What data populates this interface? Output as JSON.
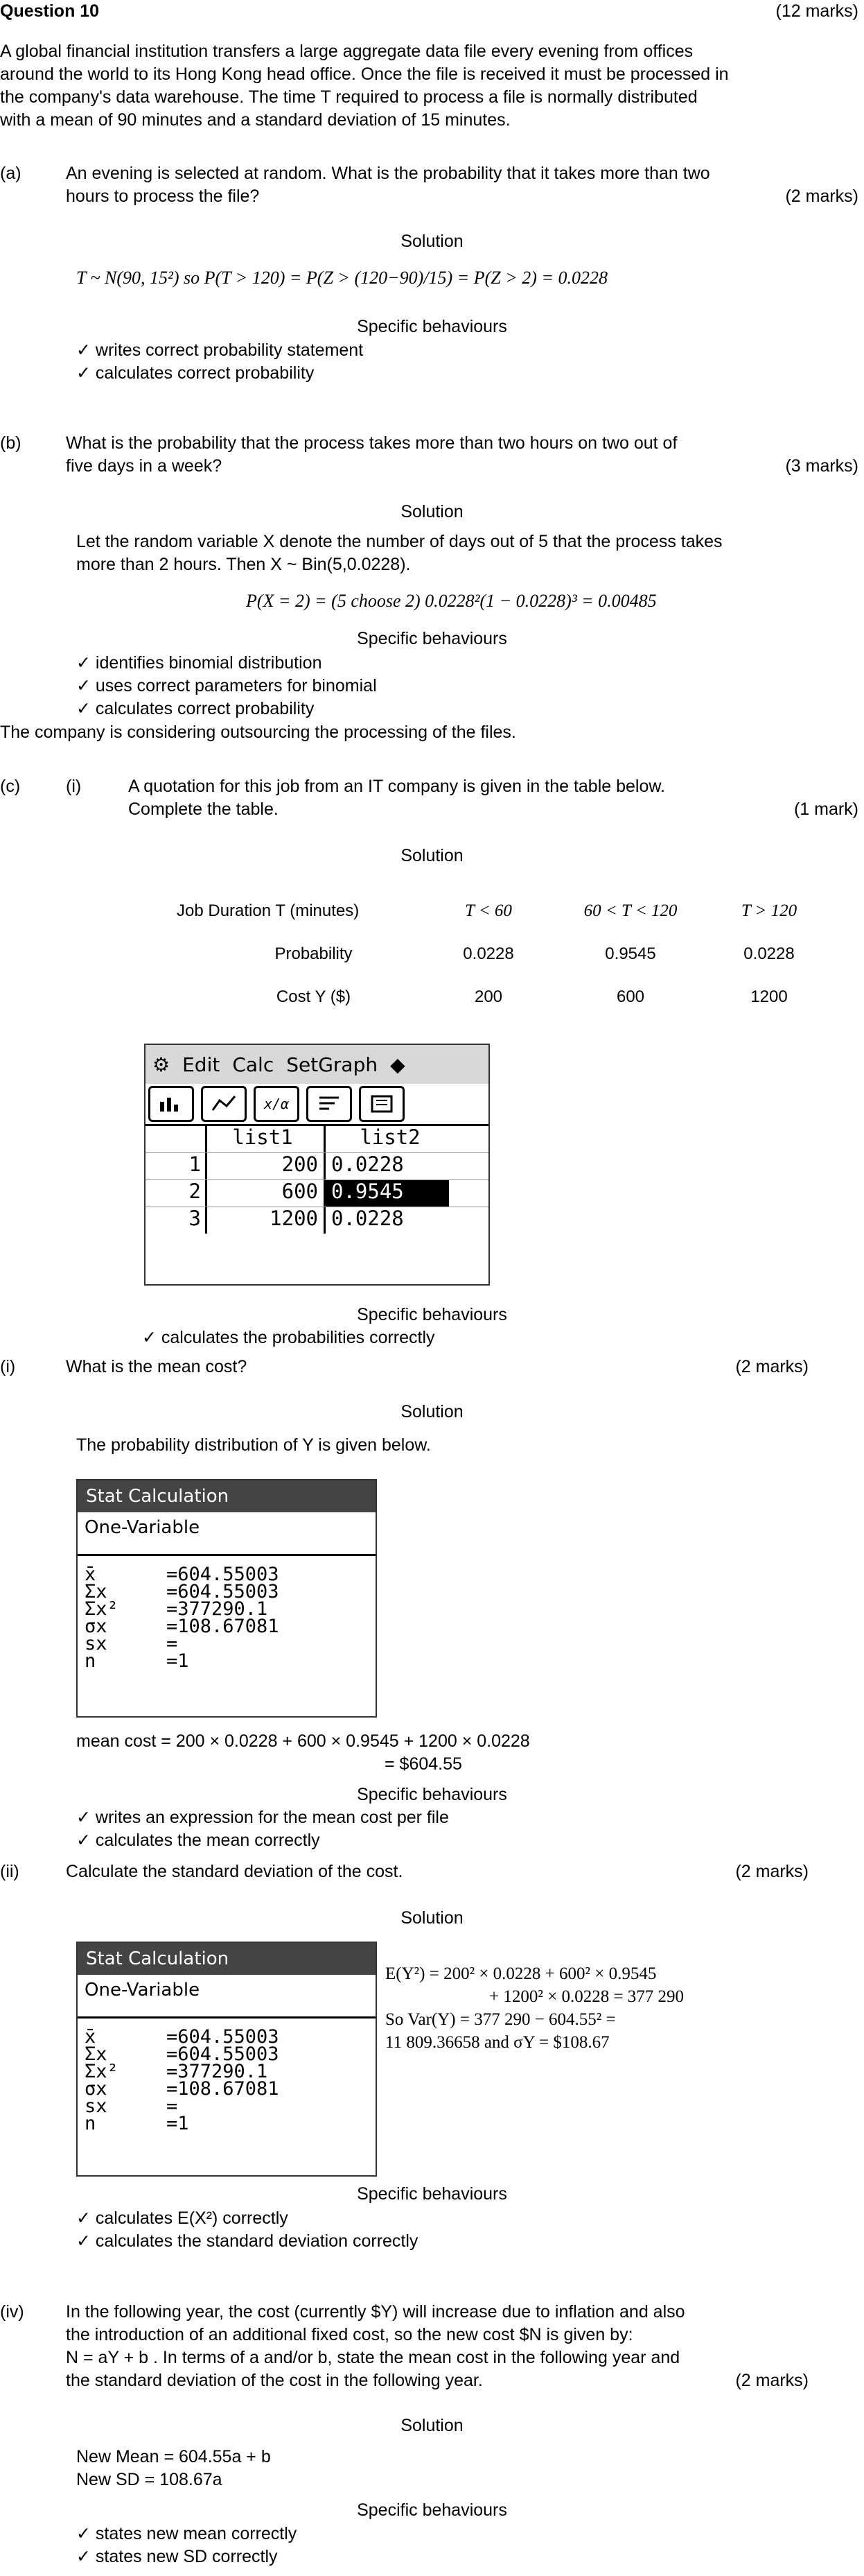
{
  "header": {
    "title": "Question 10",
    "marks": "(12 marks)"
  },
  "intro": [
    "A global financial institution transfers a large aggregate data file every evening from offices",
    "around the world to its Hong Kong head office. Once the file is received it must be processed in",
    "the company's data warehouse. The time T required to process a file is normally distributed",
    "with a mean of 90 minutes and a standard deviation of 15 minutes."
  ],
  "solution_label": "Solution",
  "sb_label": "Specific behaviours",
  "part_a": {
    "label": "(a)",
    "question": [
      "An evening is selected at random. What is the probability that it takes more than two",
      "hours to process the file?"
    ],
    "marks": "(2 marks)",
    "formula": "T ~ N(90, 15²) so P(T > 120) = P(Z > (120−90)/15) = P(Z > 2) = 0.0228",
    "behaviours": [
      "writes correct probability statement",
      "calculates correct probability"
    ]
  },
  "part_b": {
    "label": "(b)",
    "question": [
      "What is the probability that the process takes more than two hours on two out of",
      "five days in a week?"
    ],
    "marks": "(3 marks)",
    "solution": [
      "Let the random variable X denote the number of days out of 5 that the process takes",
      "more than 2 hours. Then X ~ Bin(5,0.0228)."
    ],
    "formula": "P(X = 2) = (5 choose 2) 0.0228²(1 − 0.0228)³ = 0.00485",
    "behaviours": [
      "identifies binomial distribution",
      "uses correct parameters for binomial",
      "calculates correct probability"
    ]
  },
  "outsourcing": "The company is considering outsourcing the processing of the files.",
  "part_c": {
    "label": "(c)",
    "sub_i": "(i)",
    "question": [
      "A quotation for this job from an IT company is given in the table below.",
      "Complete the table."
    ],
    "marks": "(1 mark)",
    "table": {
      "headers": [
        "Job Duration T (minutes)",
        "T < 60",
        "60 < T < 120",
        "T > 120"
      ],
      "rows": [
        [
          "Probability",
          "0.0228",
          "0.9545",
          "0.0228"
        ],
        [
          "Cost Y ($)",
          "200",
          "600",
          "1200"
        ]
      ]
    },
    "behaviours": [
      "calculates the probabilities correctly"
    ]
  },
  "calc_list": {
    "menu": [
      "Edit",
      "Calc",
      "SetGraph",
      "◆"
    ],
    "col_headers": [
      "list1",
      "list2"
    ],
    "rows": [
      [
        "1",
        "200",
        "0.0228"
      ],
      [
        "2",
        "600",
        "0.9545"
      ],
      [
        "3",
        "1200",
        "0.0228"
      ]
    ]
  },
  "part_ii_mean": {
    "label": "(i)",
    "question": "What is the mean cost?",
    "marks": "(2 marks)",
    "solution_text": "The probability distribution of Y is given below.",
    "mean_line1": "mean cost = 200 × 0.0228 + 600 × 0.9545 + 1200 × 0.0228",
    "mean_line2": "= $604.55",
    "behaviours": [
      "writes an expression for the mean cost per file",
      "calculates the mean correctly"
    ]
  },
  "stat_calc": {
    "title": "Stat Calculation",
    "sub": "One-Variable",
    "rows": [
      [
        "x̄",
        "=604.55003"
      ],
      [
        "Σx",
        "=604.55003"
      ],
      [
        "Σx²",
        "=377290.1"
      ],
      [
        "σx",
        "=108.67081"
      ],
      [
        "sx",
        "="
      ],
      [
        "n",
        "=1"
      ]
    ]
  },
  "part_ii_sd": {
    "label": "(ii)",
    "question": "Calculate the standard deviation of the cost.",
    "marks": "(2 marks)",
    "lines": [
      "E(Y²) = 200² × 0.0228 + 600² × 0.9545",
      "+ 1200² × 0.0228 = 377 290",
      "So Var(Y) = 377 290 − 604.55² =",
      "11 809.36658 and σY = $108.67"
    ],
    "behaviours": [
      "calculates E(X²) correctly",
      "calculates the standard deviation correctly"
    ]
  },
  "part_iv": {
    "label": "(iv)",
    "question": [
      "In the following year, the cost (currently $Y) will increase due to inflation and also",
      "the introduction of an additional fixed cost, so the new cost $N is given by:",
      "N = aY + b . In terms of a and/or b, state the mean cost in the following year and",
      "the standard deviation of the cost in the following year."
    ],
    "marks": "(2 marks)",
    "new_mean": "New Mean = 604.55a + b",
    "new_sd": "New SD = 108.67a",
    "behaviours": [
      "states new mean correctly",
      "states new SD correctly"
    ]
  }
}
